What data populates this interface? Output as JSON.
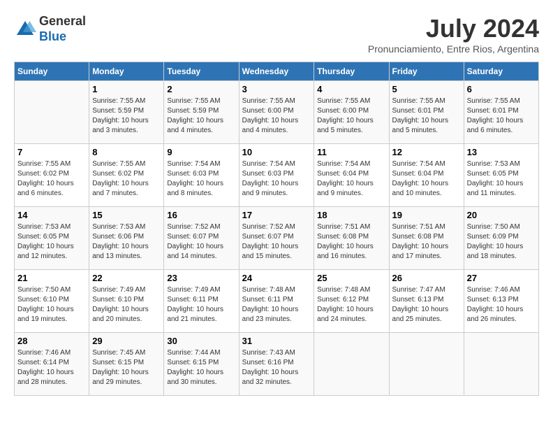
{
  "header": {
    "logo_line1": "General",
    "logo_line2": "Blue",
    "month_year": "July 2024",
    "location": "Pronunciamiento, Entre Rios, Argentina"
  },
  "days_of_week": [
    "Sunday",
    "Monday",
    "Tuesday",
    "Wednesday",
    "Thursday",
    "Friday",
    "Saturday"
  ],
  "weeks": [
    [
      {
        "num": "",
        "info": ""
      },
      {
        "num": "1",
        "info": "Sunrise: 7:55 AM\nSunset: 5:59 PM\nDaylight: 10 hours\nand 3 minutes."
      },
      {
        "num": "2",
        "info": "Sunrise: 7:55 AM\nSunset: 5:59 PM\nDaylight: 10 hours\nand 4 minutes."
      },
      {
        "num": "3",
        "info": "Sunrise: 7:55 AM\nSunset: 6:00 PM\nDaylight: 10 hours\nand 4 minutes."
      },
      {
        "num": "4",
        "info": "Sunrise: 7:55 AM\nSunset: 6:00 PM\nDaylight: 10 hours\nand 5 minutes."
      },
      {
        "num": "5",
        "info": "Sunrise: 7:55 AM\nSunset: 6:01 PM\nDaylight: 10 hours\nand 5 minutes."
      },
      {
        "num": "6",
        "info": "Sunrise: 7:55 AM\nSunset: 6:01 PM\nDaylight: 10 hours\nand 6 minutes."
      }
    ],
    [
      {
        "num": "7",
        "info": "Sunrise: 7:55 AM\nSunset: 6:02 PM\nDaylight: 10 hours\nand 6 minutes."
      },
      {
        "num": "8",
        "info": "Sunrise: 7:55 AM\nSunset: 6:02 PM\nDaylight: 10 hours\nand 7 minutes."
      },
      {
        "num": "9",
        "info": "Sunrise: 7:54 AM\nSunset: 6:03 PM\nDaylight: 10 hours\nand 8 minutes."
      },
      {
        "num": "10",
        "info": "Sunrise: 7:54 AM\nSunset: 6:03 PM\nDaylight: 10 hours\nand 9 minutes."
      },
      {
        "num": "11",
        "info": "Sunrise: 7:54 AM\nSunset: 6:04 PM\nDaylight: 10 hours\nand 9 minutes."
      },
      {
        "num": "12",
        "info": "Sunrise: 7:54 AM\nSunset: 6:04 PM\nDaylight: 10 hours\nand 10 minutes."
      },
      {
        "num": "13",
        "info": "Sunrise: 7:53 AM\nSunset: 6:05 PM\nDaylight: 10 hours\nand 11 minutes."
      }
    ],
    [
      {
        "num": "14",
        "info": "Sunrise: 7:53 AM\nSunset: 6:05 PM\nDaylight: 10 hours\nand 12 minutes."
      },
      {
        "num": "15",
        "info": "Sunrise: 7:53 AM\nSunset: 6:06 PM\nDaylight: 10 hours\nand 13 minutes."
      },
      {
        "num": "16",
        "info": "Sunrise: 7:52 AM\nSunset: 6:07 PM\nDaylight: 10 hours\nand 14 minutes."
      },
      {
        "num": "17",
        "info": "Sunrise: 7:52 AM\nSunset: 6:07 PM\nDaylight: 10 hours\nand 15 minutes."
      },
      {
        "num": "18",
        "info": "Sunrise: 7:51 AM\nSunset: 6:08 PM\nDaylight: 10 hours\nand 16 minutes."
      },
      {
        "num": "19",
        "info": "Sunrise: 7:51 AM\nSunset: 6:08 PM\nDaylight: 10 hours\nand 17 minutes."
      },
      {
        "num": "20",
        "info": "Sunrise: 7:50 AM\nSunset: 6:09 PM\nDaylight: 10 hours\nand 18 minutes."
      }
    ],
    [
      {
        "num": "21",
        "info": "Sunrise: 7:50 AM\nSunset: 6:10 PM\nDaylight: 10 hours\nand 19 minutes."
      },
      {
        "num": "22",
        "info": "Sunrise: 7:49 AM\nSunset: 6:10 PM\nDaylight: 10 hours\nand 20 minutes."
      },
      {
        "num": "23",
        "info": "Sunrise: 7:49 AM\nSunset: 6:11 PM\nDaylight: 10 hours\nand 21 minutes."
      },
      {
        "num": "24",
        "info": "Sunrise: 7:48 AM\nSunset: 6:11 PM\nDaylight: 10 hours\nand 23 minutes."
      },
      {
        "num": "25",
        "info": "Sunrise: 7:48 AM\nSunset: 6:12 PM\nDaylight: 10 hours\nand 24 minutes."
      },
      {
        "num": "26",
        "info": "Sunrise: 7:47 AM\nSunset: 6:13 PM\nDaylight: 10 hours\nand 25 minutes."
      },
      {
        "num": "27",
        "info": "Sunrise: 7:46 AM\nSunset: 6:13 PM\nDaylight: 10 hours\nand 26 minutes."
      }
    ],
    [
      {
        "num": "28",
        "info": "Sunrise: 7:46 AM\nSunset: 6:14 PM\nDaylight: 10 hours\nand 28 minutes."
      },
      {
        "num": "29",
        "info": "Sunrise: 7:45 AM\nSunset: 6:15 PM\nDaylight: 10 hours\nand 29 minutes."
      },
      {
        "num": "30",
        "info": "Sunrise: 7:44 AM\nSunset: 6:15 PM\nDaylight: 10 hours\nand 30 minutes."
      },
      {
        "num": "31",
        "info": "Sunrise: 7:43 AM\nSunset: 6:16 PM\nDaylight: 10 hours\nand 32 minutes."
      },
      {
        "num": "",
        "info": ""
      },
      {
        "num": "",
        "info": ""
      },
      {
        "num": "",
        "info": ""
      }
    ]
  ]
}
